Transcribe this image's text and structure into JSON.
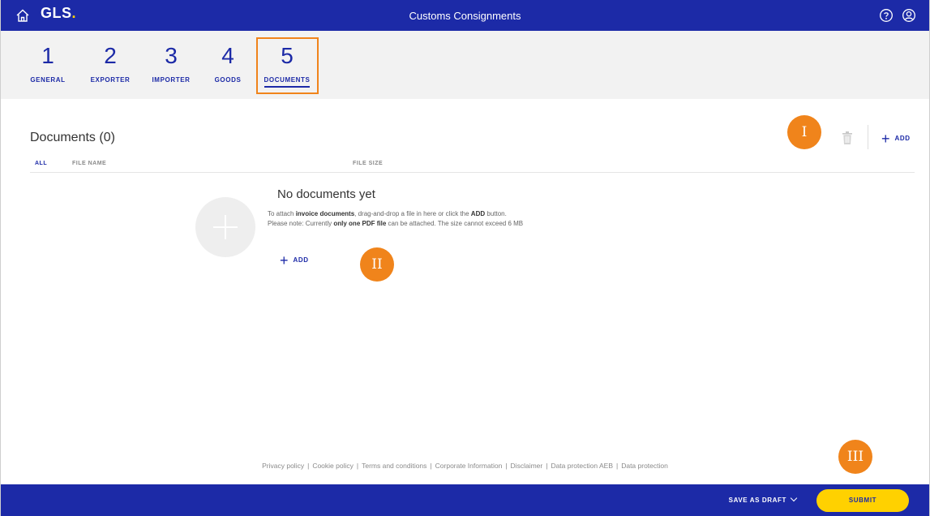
{
  "header": {
    "logo_text": "GLS",
    "logo_dot": ".",
    "title": "Customs Consignments",
    "brand_color": "#1c2aa7",
    "accent_color": "#ffd100"
  },
  "icons": {
    "home": "home-icon",
    "help": "help-icon",
    "user": "user-icon",
    "trash": "trash-icon",
    "add": "plus-icon"
  },
  "stepper": {
    "steps": [
      {
        "number": "1",
        "label": "GENERAL"
      },
      {
        "number": "2",
        "label": "EXPORTER"
      },
      {
        "number": "3",
        "label": "IMPORTER"
      },
      {
        "number": "4",
        "label": "GOODS"
      },
      {
        "number": "5",
        "label": "DOCUMENTS"
      }
    ],
    "active_index": 4
  },
  "documents": {
    "title": "Documents (0)",
    "columns": {
      "all": "ALL",
      "file_name": "FILE NAME",
      "file_size": "FILE SIZE"
    },
    "add_label": "ADD",
    "add_symbol": "+"
  },
  "empty_state": {
    "title": "No documents yet",
    "line1_a": "To attach ",
    "line1_bold1": "invoice documents",
    "line1_b": ", drag-and-drop a file in here or click the ",
    "line1_bold2": "ADD",
    "line1_c": " button.",
    "line2_a": "Please note: Currently ",
    "line2_bold": "only one PDF file",
    "line2_b": " can be attached. The size cannot exceed 6 MB",
    "add_label": "ADD",
    "add_symbol": "+"
  },
  "markers": {
    "m1": "I",
    "m2": "II",
    "m3": "III",
    "color": "#f0841b"
  },
  "footer": {
    "links": [
      "Privacy policy",
      "Cookie policy",
      "Terms and conditions",
      "Corporate Information",
      "Disclaimer",
      "Data protection AEB",
      "Data protection"
    ],
    "separator": "|"
  },
  "actions": {
    "save_draft": "SAVE AS DRAFT",
    "submit": "SUBMIT"
  }
}
